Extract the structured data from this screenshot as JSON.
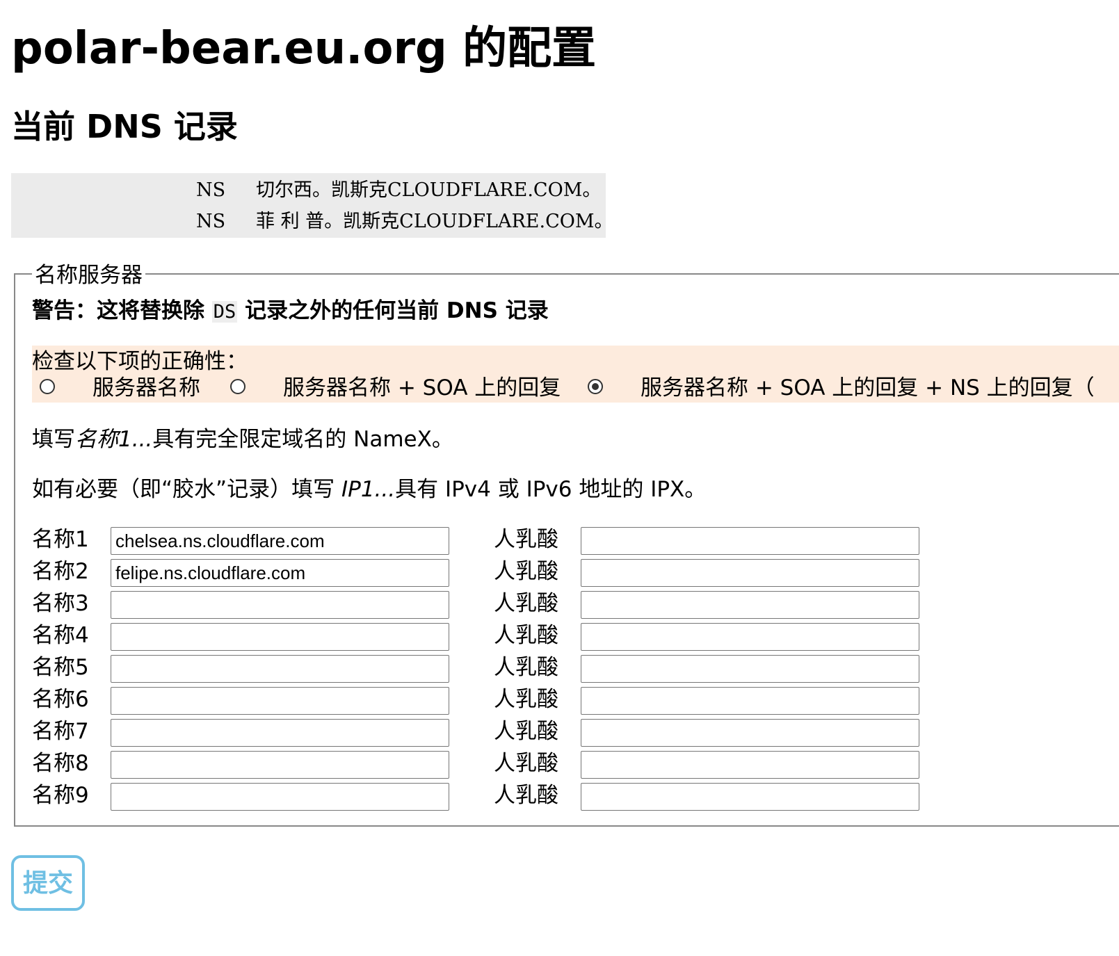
{
  "page": {
    "title": "polar-bear.eu.org 的配置",
    "subtitle": "当前 DNS 记录"
  },
  "records": [
    {
      "type": "NS",
      "value": "切尔西。凯斯克CLOUDFLARE.COM。"
    },
    {
      "type": "NS",
      "value": "菲 利 普。凯斯克CLOUDFLARE.COM。"
    }
  ],
  "form": {
    "legend": "名称服务器",
    "warning": {
      "prefix": "警告：这将替换除 ",
      "code": "DS",
      "suffix": " 记录之外的任何当前 DNS 记录"
    },
    "check": {
      "label": "检查以下项的正确性：",
      "options": [
        {
          "label": "服务器名称",
          "selected": false
        },
        {
          "label": "服务器名称 + SOA 上的回复",
          "selected": false
        },
        {
          "label": "服务器名称 + SOA 上的回复 + NS 上的回复（",
          "selected": true
        }
      ]
    },
    "fill_names": {
      "prefix": "填写",
      "italic": "名称1...",
      "suffix": "具有完全限定域名的 NameX。"
    },
    "fill_ips": {
      "prefix": "如有必要（即“胶水”记录）填写 ",
      "italic": "IP1...",
      "suffix": "具有 IPv4 或 IPv6 地址的 IPX。"
    },
    "rows": [
      {
        "name_label": "名称1",
        "name_value": "chelsea.ns.cloudflare.com",
        "ip_label": "人乳酸",
        "ip_value": ""
      },
      {
        "name_label": "名称2",
        "name_value": "felipe.ns.cloudflare.com",
        "ip_label": "人乳酸",
        "ip_value": ""
      },
      {
        "name_label": "名称3",
        "name_value": "",
        "ip_label": "人乳酸",
        "ip_value": ""
      },
      {
        "name_label": "名称4",
        "name_value": "",
        "ip_label": "人乳酸",
        "ip_value": ""
      },
      {
        "name_label": "名称5",
        "name_value": "",
        "ip_label": "人乳酸",
        "ip_value": ""
      },
      {
        "name_label": "名称6",
        "name_value": "",
        "ip_label": "人乳酸",
        "ip_value": ""
      },
      {
        "name_label": "名称7",
        "name_value": "",
        "ip_label": "人乳酸",
        "ip_value": ""
      },
      {
        "name_label": "名称8",
        "name_value": "",
        "ip_label": "人乳酸",
        "ip_value": ""
      },
      {
        "name_label": "名称9",
        "name_value": "",
        "ip_label": "人乳酸",
        "ip_value": ""
      }
    ],
    "submit_label": "提交"
  },
  "colors": {
    "records_bg": "#ebebeb",
    "check_bg": "#fdebdd",
    "submit_accent": "#6fbfe3"
  }
}
